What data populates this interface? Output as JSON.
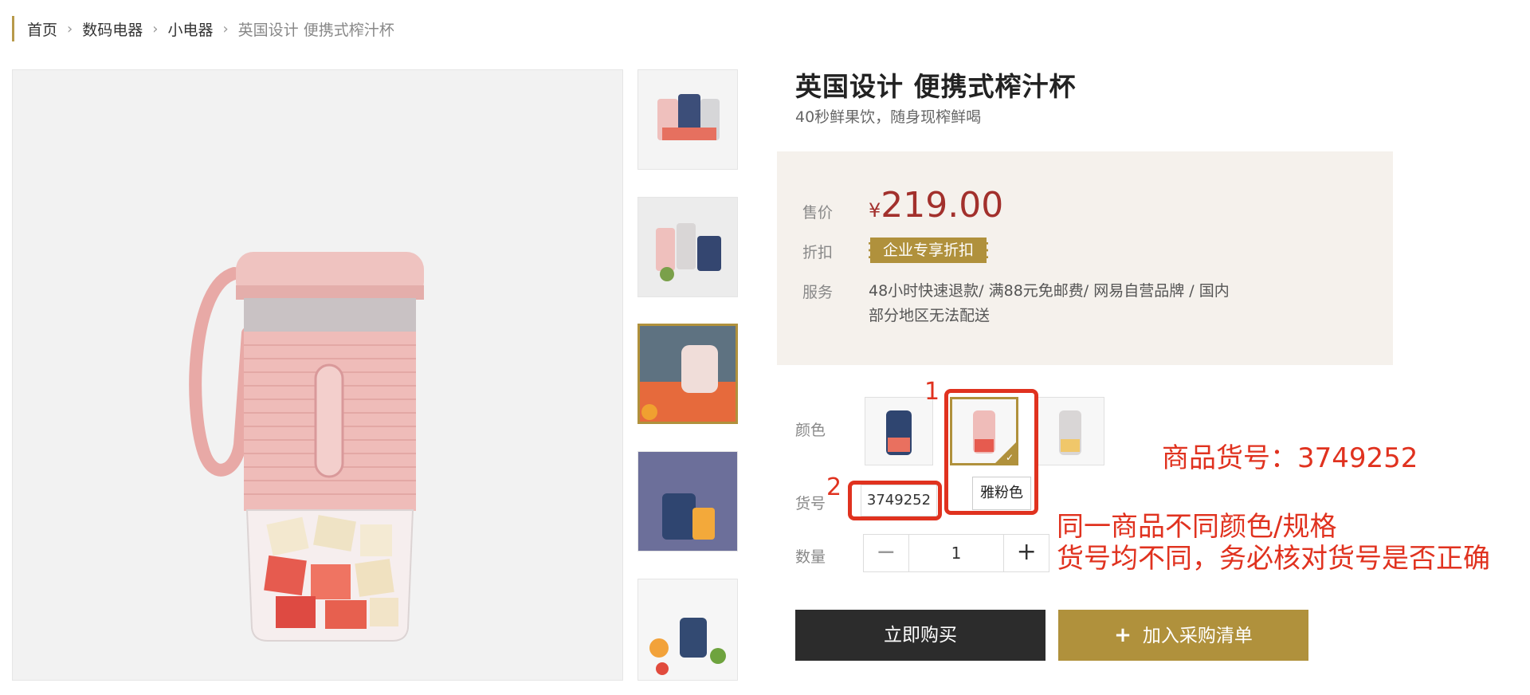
{
  "breadcrumb": {
    "items": [
      "首页",
      "数码电器",
      "小电器"
    ],
    "current": "英国设计 便携式榨汁杯"
  },
  "product": {
    "title": "英国设计 便携式榨汁杯",
    "subtitle": "40秒鲜果饮，随身现榨鲜喝",
    "price_label": "售价",
    "currency": "¥",
    "price": "219.00",
    "discount_label": "折扣",
    "discount_badge": "企业专享折扣",
    "service_label": "服务",
    "service_text": "48小时快速退款/ 满88元免邮费/ 网易自营品牌 / 国内部分地区无法配送",
    "color_label": "颜色",
    "selected_color": "雅粉色",
    "sku_label": "货号",
    "sku": "3749252",
    "qty_label": "数量",
    "qty": "1",
    "qty_minus": "−",
    "qty_plus": "+"
  },
  "actions": {
    "buy_now": "立即购买",
    "add_plus": "+",
    "add_to_list": "加入采购清单"
  },
  "annotations": {
    "marker1": "1",
    "marker2": "2",
    "sku_note": "商品货号：3749252",
    "line1": "同一商品不同颜色/规格",
    "line2": "货号均不同，务必核对货号是否正确"
  },
  "colors": {
    "accent_gold": "#b0913c",
    "price_red": "#a2302c",
    "annotation_red": "#e0321f",
    "buy_button": "#2c2c2c"
  },
  "icons": [
    "chevron-right-icon",
    "check-icon",
    "minus-icon",
    "plus-icon"
  ]
}
